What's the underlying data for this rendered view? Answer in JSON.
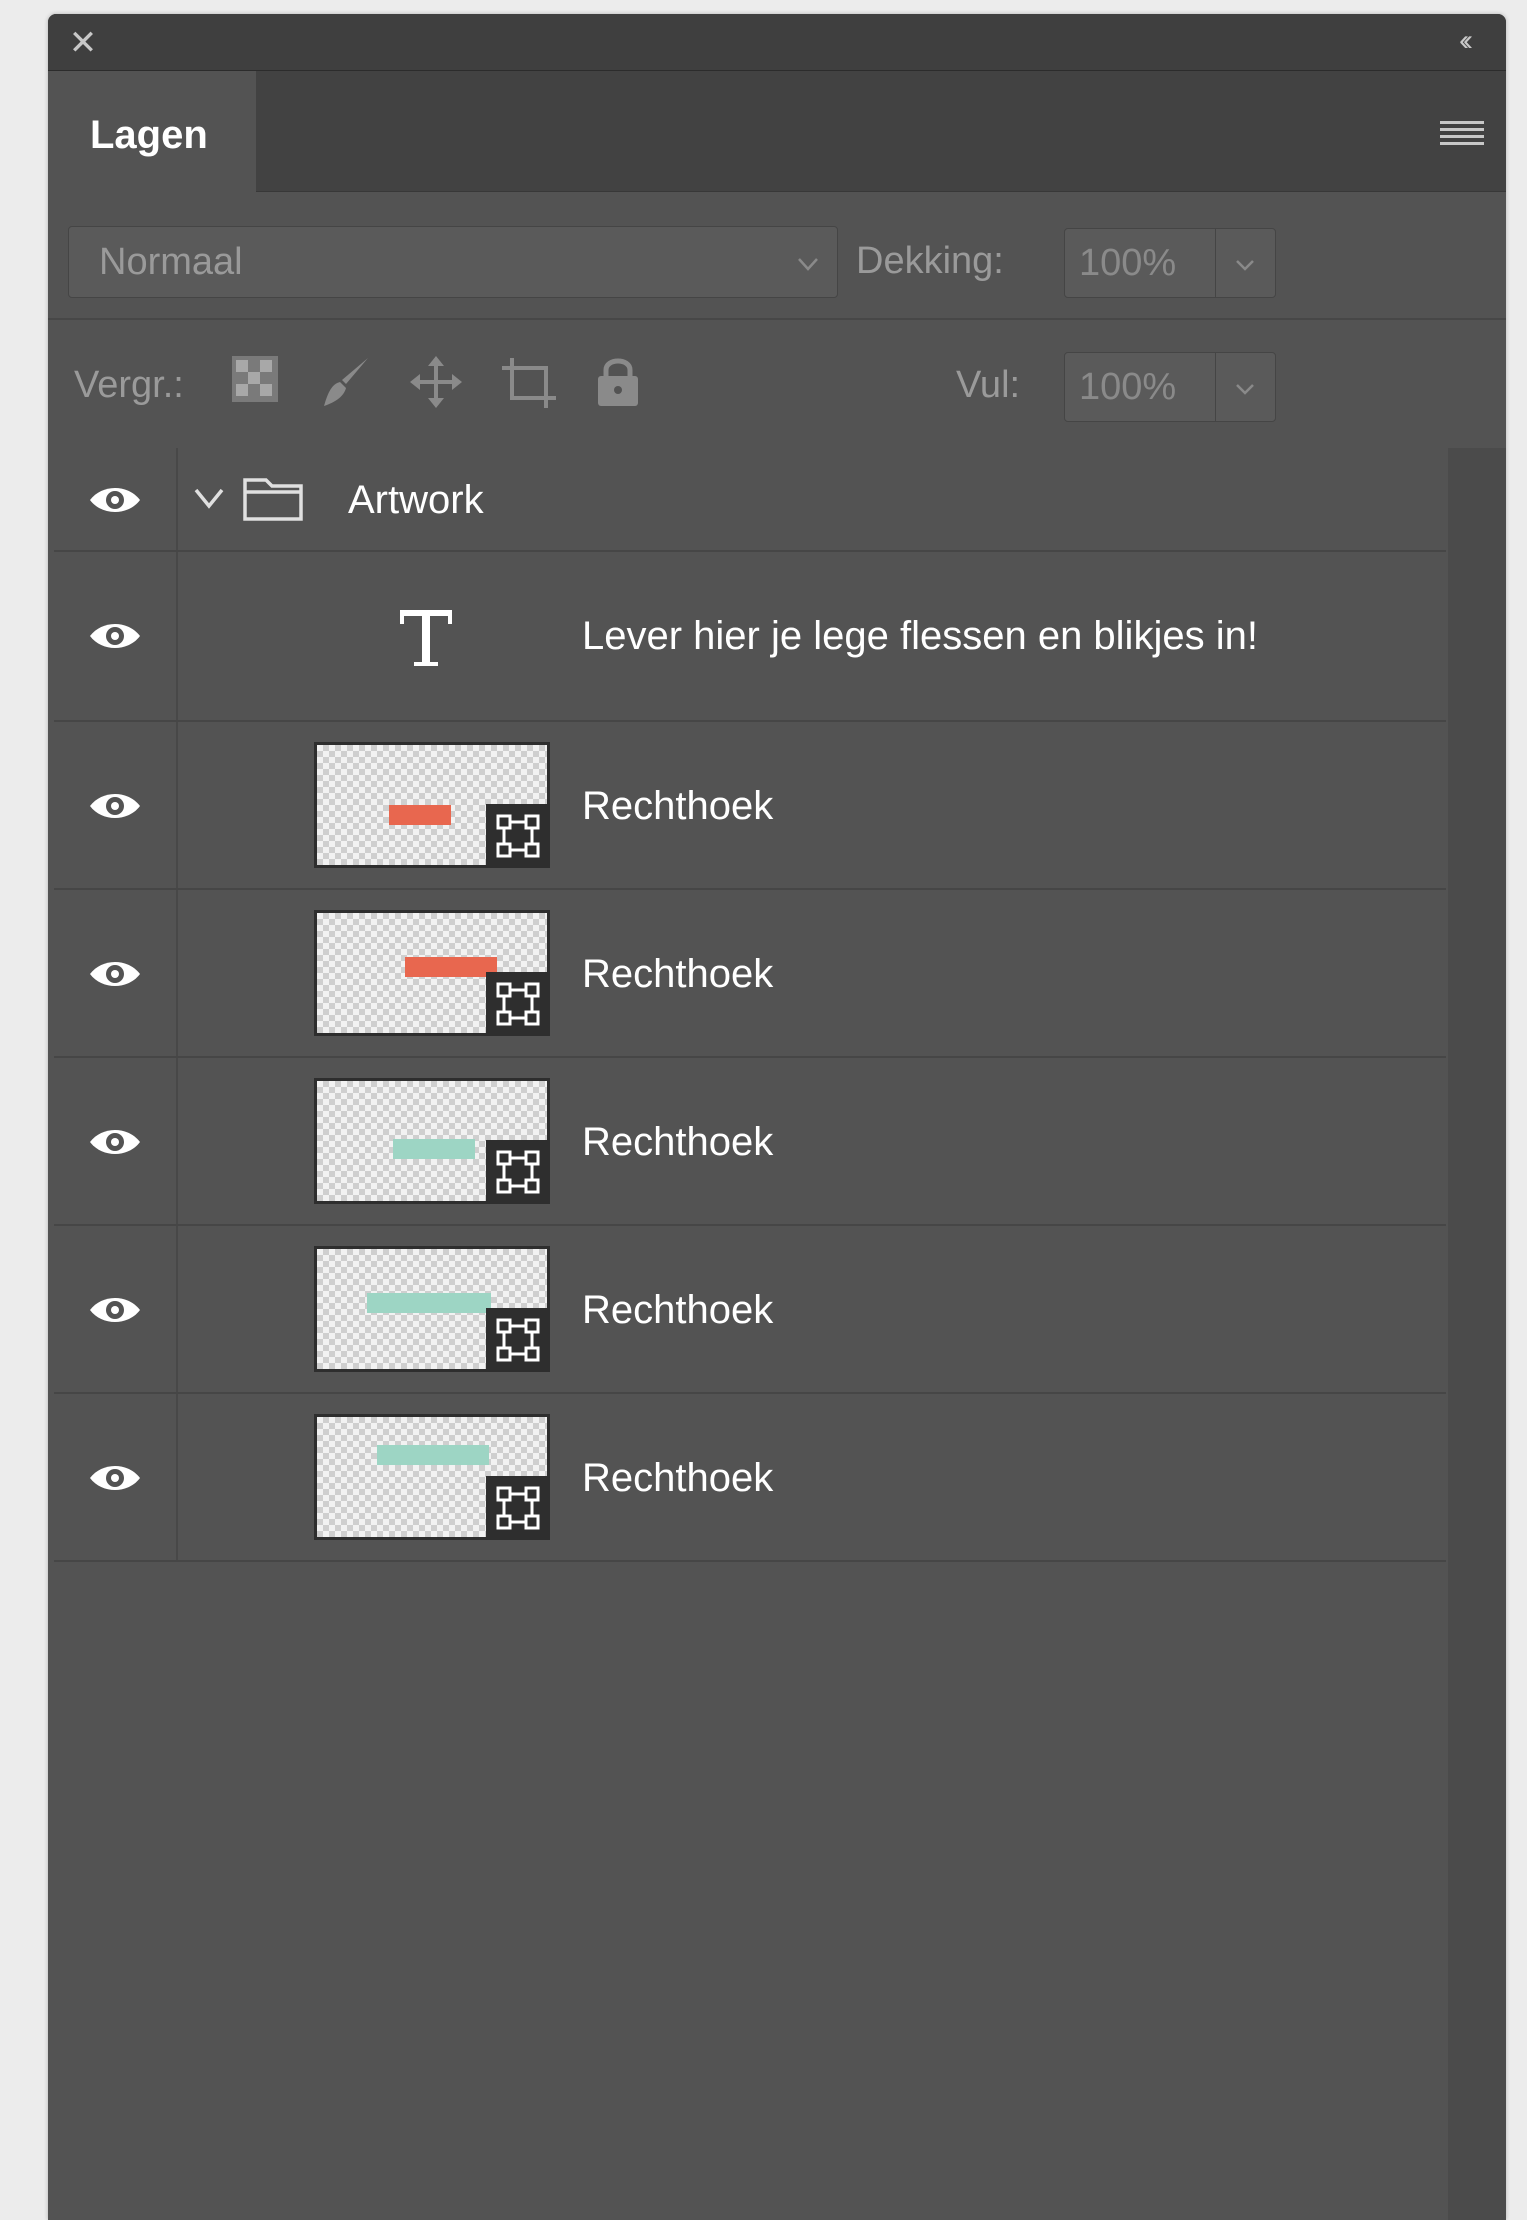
{
  "window": {
    "close_icon": "close-icon",
    "collapse_icon": "double-chevron-left-icon",
    "panel_menu_icon": "hamburger-menu-icon"
  },
  "tabs": [
    {
      "label": "Lagen",
      "active": true
    }
  ],
  "options": {
    "blend_mode": "Normaal",
    "opacity_label": "Dekking:",
    "opacity_value": "100%",
    "lock_label": "Vergr.:",
    "fill_label": "Vul:",
    "fill_value": "100%",
    "lock_icons": [
      "lock-transparency-icon",
      "lock-paint-icon",
      "lock-position-icon",
      "lock-artboard-icon",
      "lock-all-icon"
    ]
  },
  "layers": [
    {
      "type": "group",
      "name": "Artwork",
      "visible": true,
      "expanded": true
    },
    {
      "type": "text",
      "name": "Lever hier je lege flessen en blikjes in!",
      "visible": true
    },
    {
      "type": "shape",
      "name": "Rechthoek",
      "visible": true,
      "swatch": "#e8674f"
    },
    {
      "type": "shape",
      "name": "Rechthoek",
      "visible": true,
      "swatch": "#e8674f"
    },
    {
      "type": "shape",
      "name": "Rechthoek",
      "visible": true,
      "swatch": "#9dd5c4"
    },
    {
      "type": "shape",
      "name": "Rechthoek",
      "visible": true,
      "swatch": "#9dd5c4"
    },
    {
      "type": "shape",
      "name": "Rechthoek",
      "visible": true,
      "swatch": "#9dd5c4"
    }
  ],
  "colors": {
    "panel_bg": "#535353",
    "accent_red": "#e8674f",
    "accent_teal": "#9dd5c4"
  }
}
